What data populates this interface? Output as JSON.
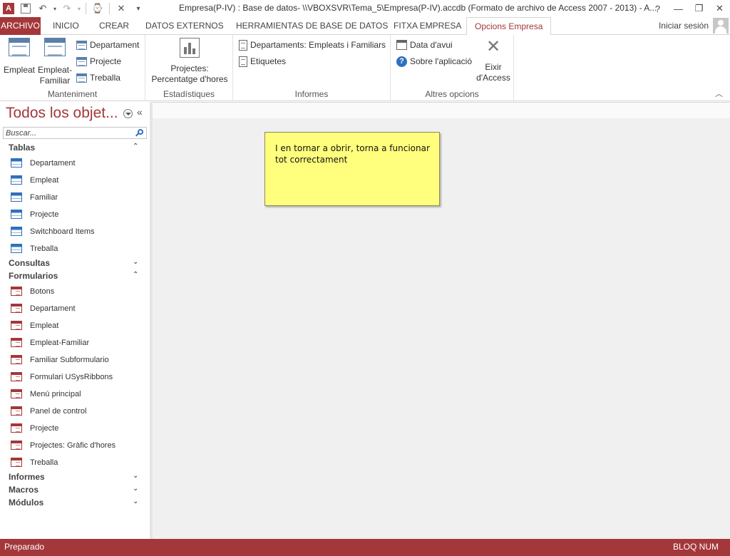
{
  "window": {
    "title": "Empresa(P-IV) : Base de datos- \\\\VBOXSVR\\Tema_5\\Empresa(P-IV).accdb (Formato de archivo de Access 2007 - 2013) - A...",
    "controls": {
      "help": "?",
      "minimize": "—",
      "restore": "❐",
      "close": "✕"
    }
  },
  "qat": {
    "app_icon": "access-icon",
    "save": "save-icon",
    "undo": "undo-icon",
    "redo": "redo-icon",
    "custom": "customize-icon"
  },
  "tabs": {
    "file": "ARCHIVO",
    "items": [
      "INICIO",
      "CREAR",
      "DATOS EXTERNOS",
      "HERRAMIENTAS DE BASE DE DATOS",
      "FITXA EMPRESA"
    ],
    "active": "Opcions Empresa",
    "signin": "Iniciar sesión"
  },
  "ribbon": {
    "manteniment": {
      "label": "Manteniment",
      "empleat": "Empleat",
      "empleat_familiar_1": "Empleat-",
      "empleat_familiar_2": "Familiar",
      "departament": "Departament",
      "projecte": "Projecte",
      "treballa": "Treballa"
    },
    "estadistiques": {
      "label": "Estadístiques",
      "projectes_1": "Projectes:",
      "projectes_2": "Percentatge d'hores"
    },
    "informes": {
      "label": "Informes",
      "departaments": "Departaments: Empleats i Familiars",
      "etiquetes": "Etiquetes"
    },
    "altres": {
      "label": "Altres opcions",
      "data_avui": "Data d'avui",
      "sobre": "Sobre l'aplicació",
      "exit_1": "Eixir",
      "exit_2": "d'Access"
    }
  },
  "nav": {
    "title": "Todos los objet...",
    "search_placeholder": "Buscar...",
    "tablas": {
      "title": "Tablas",
      "items": [
        "Departament",
        "Empleat",
        "Familiar",
        "Projecte",
        "Switchboard Items",
        "Treballa"
      ]
    },
    "consultas": {
      "title": "Consultas"
    },
    "formularios": {
      "title": "Formularios",
      "items": [
        "Botons",
        "Departament",
        "Empleat",
        "Empleat-Familiar",
        "Familiar Subformulario",
        "Formulari USysRibbons",
        "Menú principal",
        "Panel de control",
        "Projecte",
        "Projectes: Gràfic d'hores",
        "Treballa"
      ]
    },
    "informes": {
      "title": "Informes"
    },
    "macros": {
      "title": "Macros"
    },
    "modulos": {
      "title": "Módulos"
    }
  },
  "note": {
    "text": "I en tornar a obrir, torna a funcionar tot correctament"
  },
  "status": {
    "left": "Preparado",
    "right": "BLOQ NUM"
  },
  "colors": {
    "accent": "#a4373a",
    "note_bg": "#ffff7d"
  }
}
